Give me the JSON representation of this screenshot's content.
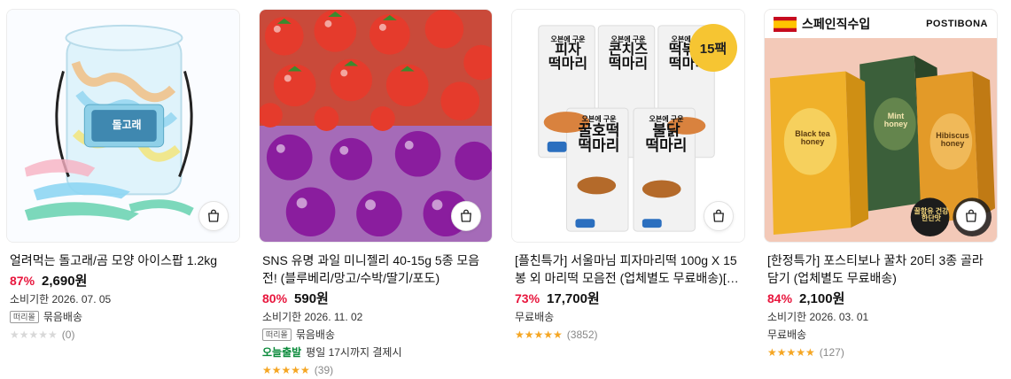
{
  "products": [
    {
      "title": "얼려먹는 돌고래/곰 모양 아이스팝 1.2kg",
      "discount": "87%",
      "price": "2,690원",
      "expiry": "소비기한 2026. 07. 05",
      "brand_tag": "떠리몰",
      "bundle": "묶음배송",
      "today_label": "",
      "today_note": "",
      "ship": "",
      "rating": 0,
      "reviews": "(0)",
      "image_text": "돌고래"
    },
    {
      "title": "SNS 유명 과일 미니젤리 40-15g 5종 모음전! (블루베리/망고/수박/딸기/포도)",
      "discount": "80%",
      "price": "590원",
      "expiry": "소비기한 2026. 11. 02",
      "brand_tag": "떠리몰",
      "bundle": "묶음배송",
      "today_label": "오늘출발",
      "today_note": "평일 17시까지 결제시",
      "ship": "",
      "rating": 5,
      "reviews": "(39)"
    },
    {
      "title": "[플친특가] 서울마님 피자마리떡 100g X 15봉 외 마리떡 모음전 (업체별도 무료배송)[대량구...",
      "discount": "73%",
      "price": "17,700원",
      "expiry": "",
      "ship": "무료배송",
      "rating": 5,
      "reviews": "(3852)",
      "badge": "15팩",
      "packs": [
        {
          "sub": "오븐에 구운",
          "name": "피자\n떡마리"
        },
        {
          "sub": "오븐에 구운",
          "name": "콘치즈\n떡마리"
        },
        {
          "sub": "오븐에 구운",
          "name": "떡볶이\n떡마리"
        },
        {
          "sub": "오븐에 구운",
          "name": "꿀호떡\n떡마리"
        },
        {
          "sub": "오븐에 구운",
          "name": "불닭\n떡마리"
        }
      ]
    },
    {
      "title": "[한정특가] 포스티보나 꿀차 20티 3종 골라담기 (업체별도 무료배송)",
      "discount": "84%",
      "price": "2,100원",
      "expiry": "소비기한 2026. 03. 01",
      "ship": "무료배송",
      "rating": 5,
      "reviews": "(127)",
      "header_text": "스페인직수입",
      "brand": "POSTIBONA",
      "boxes": [
        "Mint honey",
        "Black tea honey",
        "Hibiscus honey"
      ],
      "sticker": "꿀함유 건강한단맛"
    }
  ],
  "colors": {
    "discount": "#e8163d",
    "today": "#0a8a3a",
    "star": "#f5a623",
    "badge": "#f6c532"
  }
}
